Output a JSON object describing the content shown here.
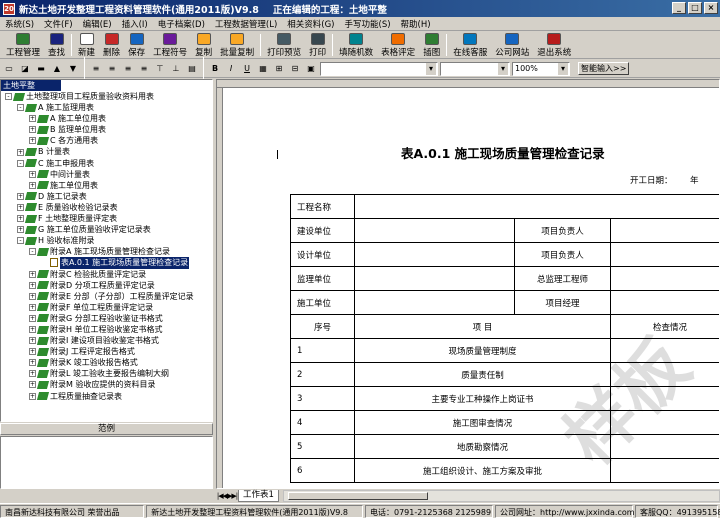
{
  "window": {
    "app_icon": "20",
    "title": "新达土地开发整理工程资料管理软件(通用2011版)V9.8",
    "state": "正在编辑的工程：土地平整",
    "controls": [
      "_",
      "□",
      "×"
    ]
  },
  "menu": [
    "系统(S)",
    "文件(F)",
    "编辑(E)",
    "插入(I)",
    "电子档案(D)",
    "工程数据管理(L)",
    "相关资料(G)",
    "手写功能(S)",
    "帮助(H)"
  ],
  "toolbar": [
    {
      "label": "工程管理",
      "icon": "project-icon",
      "color": "#2e7d32"
    },
    {
      "label": "查找",
      "icon": "binoculars-icon",
      "color": "#1a237e"
    },
    {
      "label": "新建",
      "icon": "new-doc-icon",
      "color": "#ffffff"
    },
    {
      "label": "删除",
      "icon": "delete-icon",
      "color": "#c62828"
    },
    {
      "label": "保存",
      "icon": "save-icon",
      "color": "#1565c0"
    },
    {
      "label": "工程符号",
      "icon": "symbol-icon",
      "color": "#6a1b9a"
    },
    {
      "label": "复制",
      "icon": "copy-icon",
      "color": "#f9a825"
    },
    {
      "label": "批量复制",
      "icon": "batch-copy-icon",
      "color": "#f9a825"
    },
    {
      "label": "打印预览",
      "icon": "print-preview-icon",
      "color": "#455a64"
    },
    {
      "label": "打印",
      "icon": "printer-icon",
      "color": "#37474f"
    },
    {
      "label": "填随机数",
      "icon": "random-icon",
      "color": "#00838f"
    },
    {
      "label": "表格评定",
      "icon": "grade-icon",
      "color": "#ef6c00"
    },
    {
      "label": "插图",
      "icon": "image-icon",
      "color": "#2e7d32"
    },
    {
      "label": "在线客服",
      "icon": "support-icon",
      "color": "#0277bd"
    },
    {
      "label": "公司网站",
      "icon": "globe-icon",
      "color": "#1565c0"
    },
    {
      "label": "退出系统",
      "icon": "exit-icon",
      "color": "#b71c1c"
    }
  ],
  "format_bar": {
    "bold": "B",
    "italic": "I",
    "underline": "U",
    "zoom": "100%",
    "smart_input": "智能输入>>"
  },
  "sidebar": {
    "header": "土地平整",
    "tree": [
      {
        "level": 0,
        "label": "土地整理项目工程质量验收资料用表",
        "expander": "-",
        "icon": "book"
      },
      {
        "level": 1,
        "label": "A 施工监理用表",
        "expander": "-",
        "icon": "book"
      },
      {
        "level": 2,
        "label": "A 施工单位用表",
        "expander": "+",
        "icon": "book"
      },
      {
        "level": 2,
        "label": "B 监理单位用表",
        "expander": "+",
        "icon": "book"
      },
      {
        "level": 2,
        "label": "C 各方通用表",
        "expander": "+",
        "icon": "book"
      },
      {
        "level": 1,
        "label": "B 计量表",
        "expander": "+",
        "icon": "book"
      },
      {
        "level": 1,
        "label": "C 施工申报用表",
        "expander": "-",
        "icon": "book"
      },
      {
        "level": 2,
        "label": "中间计量表",
        "expander": "+",
        "icon": "book"
      },
      {
        "level": 2,
        "label": "施工单位用表",
        "expander": "+",
        "icon": "book"
      },
      {
        "level": 1,
        "label": "D 施工记录表",
        "expander": "+",
        "icon": "book"
      },
      {
        "level": 1,
        "label": "E 质量验收检验记录表",
        "expander": "+",
        "icon": "book"
      },
      {
        "level": 1,
        "label": "F 土地整理质量评定表",
        "expander": "+",
        "icon": "book"
      },
      {
        "level": 1,
        "label": "G 施工单位质量验收评定记录表",
        "expander": "+",
        "icon": "book"
      },
      {
        "level": 1,
        "label": "H 验收标准附录",
        "expander": "-",
        "icon": "book"
      },
      {
        "level": 2,
        "label": "附录A 施工现场质量管理检查记录",
        "expander": "-",
        "icon": "book"
      },
      {
        "level": 3,
        "label": "表A.0.1 施工现场质量管理检查记录",
        "expander": "",
        "icon": "doc",
        "selected": true
      },
      {
        "level": 2,
        "label": "附录C 检验批质量评定记录",
        "expander": "+",
        "icon": "book"
      },
      {
        "level": 2,
        "label": "附录D 分项工程质量评定记录",
        "expander": "+",
        "icon": "book"
      },
      {
        "level": 2,
        "label": "附录E 分部（子分部）工程质量评定记录",
        "expander": "+",
        "icon": "book"
      },
      {
        "level": 2,
        "label": "附录F 单位工程质量评定记录",
        "expander": "+",
        "icon": "book"
      },
      {
        "level": 2,
        "label": "附录G 分部工程验收鉴证书格式",
        "expander": "+",
        "icon": "book"
      },
      {
        "level": 2,
        "label": "附录H 单位工程验收鉴定书格式",
        "expander": "+",
        "icon": "book"
      },
      {
        "level": 2,
        "label": "附录I 建设项目验收鉴定书格式",
        "expander": "+",
        "icon": "book"
      },
      {
        "level": 2,
        "label": "附录J 工程评定报告格式",
        "expander": "+",
        "icon": "book"
      },
      {
        "level": 2,
        "label": "附录K 竣工验收报告格式",
        "expander": "+",
        "icon": "book"
      },
      {
        "level": 2,
        "label": "附录L 竣工验收主要报告编制大纲",
        "expander": "+",
        "icon": "book"
      },
      {
        "level": 2,
        "label": "附录M 验收应提供的资料目录",
        "expander": "+",
        "icon": "book"
      },
      {
        "level": 2,
        "label": "工程质量抽查记录表",
        "expander": "+",
        "icon": "book"
      }
    ]
  },
  "preview_label": "范例",
  "document": {
    "title": "表A.0.1  施工现场质量管理检查记录",
    "date_label": "开工日期：",
    "date_suffix": "年",
    "watermark": "样板",
    "info_rows": [
      {
        "label": "工程名称",
        "right_label": "",
        "right_value": ""
      },
      {
        "label": "建设单位",
        "right_label": "项目负责人",
        "right_value": ""
      },
      {
        "label": "设计单位",
        "right_label": "项目负责人",
        "right_value": ""
      },
      {
        "label": "监理单位",
        "right_label": "总监理工程师",
        "right_value": ""
      },
      {
        "label": "施工单位",
        "right_label": "项目经理",
        "right_value": ""
      }
    ],
    "table_header": {
      "no": "序号",
      "item": "项        目",
      "status": "检查情况"
    },
    "items": [
      {
        "no": "1",
        "item": "现场质量管理制度",
        "status": ""
      },
      {
        "no": "2",
        "item": "质量责任制",
        "status": ""
      },
      {
        "no": "3",
        "item": "主要专业工种操作上岗证书",
        "status": ""
      },
      {
        "no": "4",
        "item": "施工图审查情况",
        "status": ""
      },
      {
        "no": "5",
        "item": "地质勘察情况",
        "status": ""
      },
      {
        "no": "6",
        "item": "施工组织设计、施工方案及审批",
        "status": ""
      }
    ]
  },
  "sheet_tab": "工作表1",
  "status": [
    "南昌新达科技有限公司 荣誉出品",
    "新达土地开发整理工程资料管理软件(通用2011版)V9.8",
    "电话：0791-2125368 2125989",
    "公司网址：http://www.jxxinda.com",
    "客服QQ：491395158"
  ]
}
